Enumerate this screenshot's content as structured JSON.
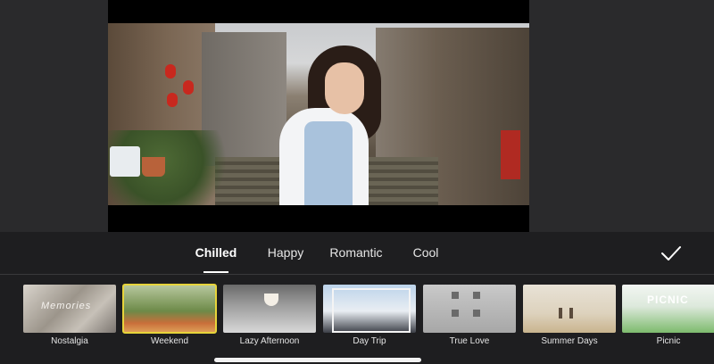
{
  "tabs": [
    {
      "label": "Chilled",
      "active": true
    },
    {
      "label": "Happy",
      "active": false
    },
    {
      "label": "Romantic",
      "active": false
    },
    {
      "label": "Cool",
      "active": false
    }
  ],
  "confirm_icon": "checkmark-icon",
  "filters": [
    {
      "label": "Nostalgia",
      "selected": false,
      "thumb_text": "Memories"
    },
    {
      "label": "Weekend",
      "selected": true
    },
    {
      "label": "Lazy Afternoon",
      "selected": false
    },
    {
      "label": "Day Trip",
      "selected": false
    },
    {
      "label": "True Love",
      "selected": false
    },
    {
      "label": "Summer Days",
      "selected": false
    },
    {
      "label": "Picnic",
      "selected": false,
      "thumb_text": "PICNIC"
    }
  ],
  "colors": {
    "selected_outline": "#e7d43a",
    "panel_background": "#1e1e20",
    "text": "#ffffff"
  }
}
